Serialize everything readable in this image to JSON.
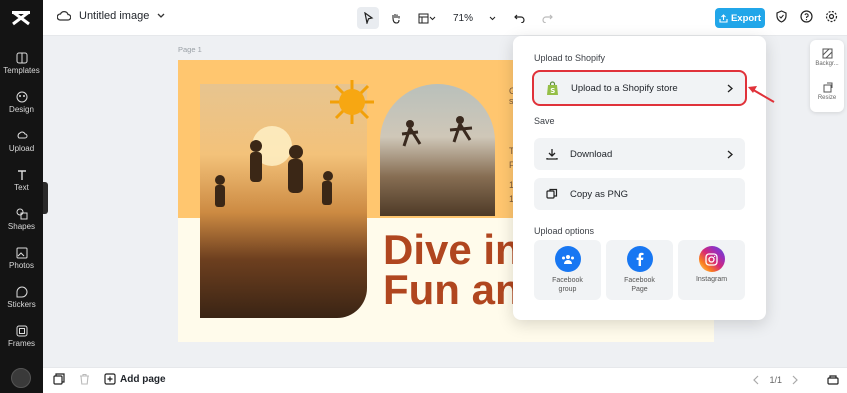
{
  "rail": {
    "items": [
      {
        "label": "Templates",
        "icon": "templates-icon"
      },
      {
        "label": "Design",
        "icon": "design-icon"
      },
      {
        "label": "Upload",
        "icon": "upload-icon"
      },
      {
        "label": "Text",
        "icon": "text-icon"
      },
      {
        "label": "Shapes",
        "icon": "shapes-icon"
      },
      {
        "label": "Photos",
        "icon": "photos-icon"
      },
      {
        "label": "Stickers",
        "icon": "stickers-icon"
      },
      {
        "label": "Frames",
        "icon": "frames-icon"
      }
    ]
  },
  "topbar": {
    "doc_title": "Untitled image",
    "zoom": "71%",
    "export_label": "Export"
  },
  "canvas": {
    "page_label": "Page 1",
    "headline": "Dive in\nFun an",
    "fragments": [
      "G",
      "s",
      "T",
      "F",
      "1",
      "1"
    ]
  },
  "side_panel": {
    "items": [
      {
        "label": "Backgr..."
      },
      {
        "label": "Resize"
      }
    ]
  },
  "export_menu": {
    "shopify_section": "Upload to Shopify",
    "shopify_button": "Upload to a Shopify store",
    "save_section": "Save",
    "download_label": "Download",
    "copy_png_label": "Copy as PNG",
    "upload_options_section": "Upload options",
    "options": [
      {
        "label": "Facebook\ngroup",
        "color": "#1877f2"
      },
      {
        "label": "Facebook\nPage",
        "color": "#1877f2"
      },
      {
        "label": "Instagram",
        "color": "#dd2a7b"
      }
    ]
  },
  "bottombar": {
    "add_page": "Add page",
    "page_count": "1/1"
  },
  "colors": {
    "accent": "#21a6e9",
    "highlight": "#e0323a",
    "headline": "#b0461f"
  }
}
